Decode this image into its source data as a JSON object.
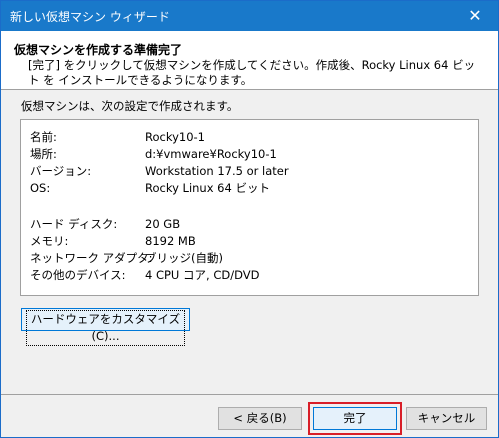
{
  "window": {
    "title": "新しい仮想マシン ウィザード",
    "close_label": "✕"
  },
  "header": {
    "title": "仮想マシンを作成する準備完了",
    "description": "[完了] をクリックして仮想マシンを作成してください。作成後、Rocky Linux 64 ビット を インストールできるようになります。"
  },
  "intro": "仮想マシンは、次の設定で作成されます。",
  "summary": {
    "rows": [
      {
        "label": "名前:",
        "value": "Rocky10-1"
      },
      {
        "label": "場所:",
        "value": "d:¥vmware¥Rocky10-1"
      },
      {
        "label": "バージョン:",
        "value": "Workstation 17.5 or later"
      },
      {
        "label": "OS:",
        "value": "Rocky Linux 64 ビット"
      },
      {
        "label": "ハード ディスク:",
        "value": "20 GB"
      },
      {
        "label": "メモリ:",
        "value": "8192 MB"
      },
      {
        "label": "ネットワーク アダプタ:",
        "value": "ブリッジ(自動)"
      },
      {
        "label": "その他のデバイス:",
        "value": "4 CPU コア, CD/DVD"
      }
    ]
  },
  "buttons": {
    "customize": "ハードウェアをカスタマイズ(C)...",
    "back": "< 戻る(B)",
    "finish": "完了",
    "cancel": "キャンセル"
  }
}
